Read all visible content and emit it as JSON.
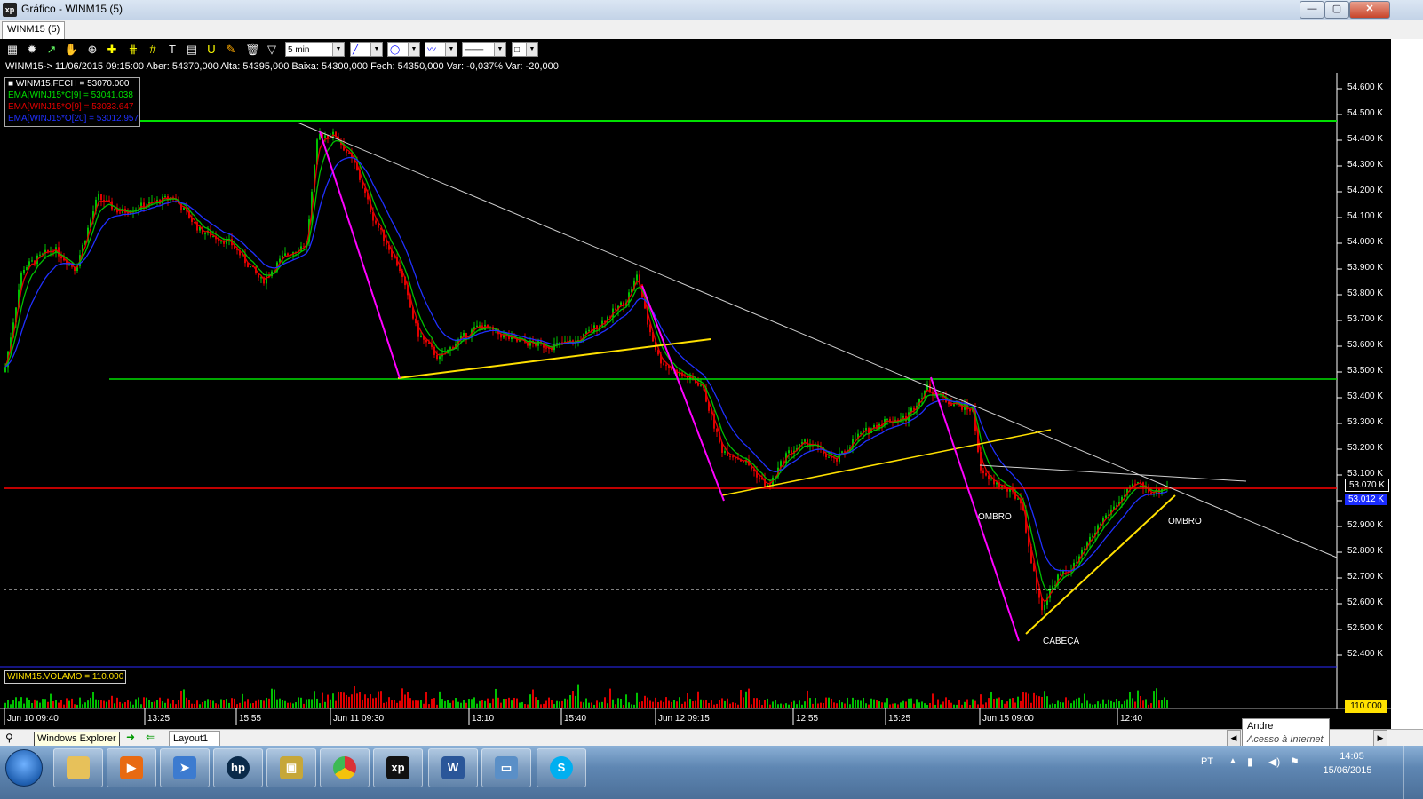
{
  "window": {
    "title": "Gráfico - WINM15 (5)",
    "app_icon": "xp",
    "minimize_label": "—",
    "maximize_label": "▢",
    "close_label": "✕"
  },
  "doc_tab": "WINM15 (5)",
  "toolbar": {
    "interval": "5 min",
    "icons": [
      "bar-chart-icon",
      "settings-gear-icon",
      "line-tool-icon",
      "hand-icon",
      "zoom-icon",
      "crosshair-icon",
      "grid-icon",
      "text-icon",
      "channel-icon",
      "brush-icon",
      "calculator-icon",
      "trash-icon",
      "filter-icon"
    ]
  },
  "quote_line": "WINM15-> 11/06/2015 09:15:00 Aber: 54370,000 Alta: 54395,000 Baixa: 54300,000 Fech: 54350,000 Var: -0,037% Var: -20,000",
  "legend": {
    "close": "WINM15.FECH = 53070.000",
    "ema_c": "EMA[WINJ15*C[9] = 53041.038",
    "ema_o": "EMA[WINJ15*O[9] = 53033.647",
    "ema3": "EMA[WINJ15*O[20] = 53012.957"
  },
  "price_axis": [
    "54.600 K",
    "54.500 K",
    "54.400 K",
    "54.300 K",
    "54.200 K",
    "54.100 K",
    "54.000 K",
    "53.900 K",
    "53.800 K",
    "53.700 K",
    "53.600 K",
    "53.500 K",
    "53.400 K",
    "53.300 K",
    "53.200 K",
    "53.100 K",
    "53.000 K",
    "52.900 K",
    "52.800 K",
    "52.700 K",
    "52.600 K",
    "52.500 K",
    "52.400 K"
  ],
  "price_tags": {
    "last": "53.070 K",
    "ema": "53.012 K"
  },
  "time_axis": [
    "Jun 10 09:40",
    "13:25",
    "15:55",
    "Jun 11 09:30",
    "13:10",
    "15:40",
    "Jun 12 09:15",
    "12:55",
    "15:25",
    "Jun 15 09:00",
    "12:40"
  ],
  "annotations": {
    "ombro_left": "OMBRO",
    "ombro_right": "OMBRO",
    "cabeca": "CABEÇA"
  },
  "volume": {
    "label": "WINM15.VOLAMO = 110.000",
    "value": "110.000"
  },
  "bottom": {
    "layout_tab": "Layout1",
    "tooltip": "Windows Explorer",
    "user_name": "Andre",
    "user_status": "Acesso à Internet"
  },
  "taskbar": {
    "apps": [
      "file-explorer-icon",
      "media-player-icon",
      "network-icon",
      "hp-icon",
      "scanner-icon",
      "chrome-icon",
      "xp-app-icon",
      "word-icon",
      "image-viewer-icon",
      "skype-icon"
    ],
    "lang": "PT",
    "time": "14:05",
    "date": "15/06/2015"
  },
  "colors": {
    "background": "#000000",
    "up": "#00c000",
    "down": "#e00000",
    "ema_fast": "#e00000",
    "ema_mid": "#00c000",
    "ema_slow": "#2030ff",
    "support": "#00e000",
    "price_line": "#ff0000",
    "trend": "#ffffff",
    "channel": "#ffe000",
    "impulse": "#ff00ff"
  }
}
